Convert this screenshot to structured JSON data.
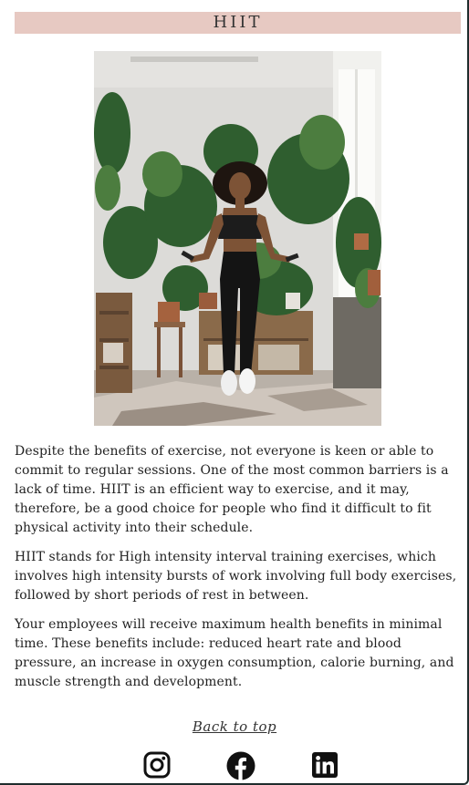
{
  "header": {
    "title": "HIIT"
  },
  "article": {
    "paragraphs": [
      "Despite the benefits of exercise, not everyone is keen or able to commit to regular sessions. One of the most common barriers is a lack of time. HIIT is an efficient way to exercise, and it may, therefore, be a good choice for people who find it difficult to fit physical activity into their schedule.",
      "HIIT stands for High intensity interval training exercises, which involves high intensity bursts of work involving full body exercises, followed by short periods of rest in between.",
      "Your employees will receive maximum health benefits in minimal time. These benefits include: reduced heart rate and blood pressure, an increase in oxygen consumption, calorie burning, and muscle strength and development."
    ]
  },
  "footer": {
    "back_to_top": "Back to top",
    "social_icons": [
      "instagram-icon",
      "facebook-icon",
      "linkedin-icon"
    ]
  },
  "colors": {
    "title_bar": "#e7c9c2",
    "text": "#222222",
    "icon": "#111111"
  }
}
